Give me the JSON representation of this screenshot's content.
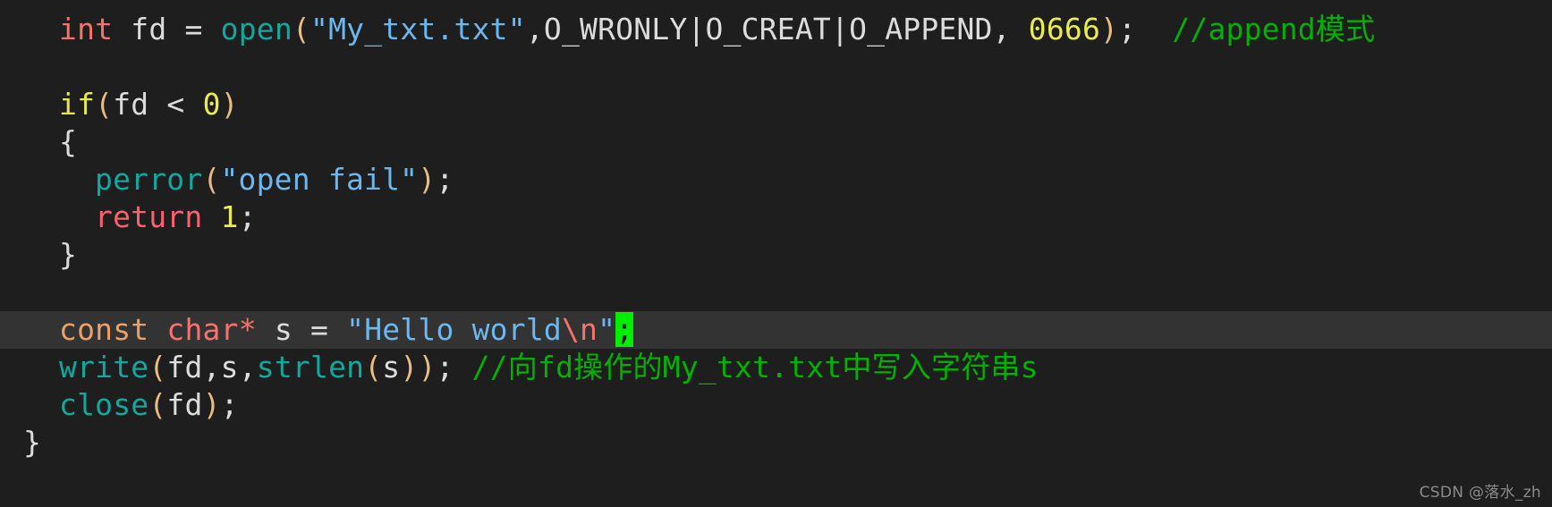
{
  "editor": {
    "background_color": "#1e1e1e",
    "highlight_line_color": "#333333",
    "default_text_color": "#d4d4d4",
    "language": "C",
    "palette": {
      "type_keyword": "#f8726c",
      "const_keyword": "#e9a06b",
      "control_keyword": "#e8e84a",
      "return_keyword": "#f8636c",
      "function": "#11a8a0",
      "string": "#6cb8ee",
      "escape": "#f8726c",
      "number": "#eaea55",
      "comment": "#00b100",
      "punctuation": "#e9bc82",
      "search_match_background": "#00ee00"
    },
    "lines": [
      {
        "id": "line-open",
        "indent": 0,
        "highlighted": false,
        "tokens": [
          {
            "text": "int",
            "style": "t-kw-type"
          },
          {
            "text": " fd ",
            "style": "t-plain"
          },
          {
            "text": "=",
            "style": "t-op"
          },
          {
            "text": " ",
            "style": "t-plain"
          },
          {
            "text": "open",
            "style": "t-func"
          },
          {
            "text": "(",
            "style": "t-punct"
          },
          {
            "text": "\"My_txt.txt\"",
            "style": "t-string"
          },
          {
            "text": ",",
            "style": "t-plain"
          },
          {
            "text": "O_WRONLY",
            "style": "t-plain"
          },
          {
            "text": "|",
            "style": "t-plain"
          },
          {
            "text": "O_CREAT",
            "style": "t-plain"
          },
          {
            "text": "|",
            "style": "t-plain"
          },
          {
            "text": "O_APPEND",
            "style": "t-plain"
          },
          {
            "text": ", ",
            "style": "t-plain"
          },
          {
            "text": "0666",
            "style": "t-number"
          },
          {
            "text": ")",
            "style": "t-punct"
          },
          {
            "text": ";",
            "style": "t-plain"
          },
          {
            "text": "  ",
            "style": "t-plain"
          },
          {
            "text": "//append模式",
            "style": "t-comment"
          }
        ]
      },
      {
        "id": "line-blank-1",
        "indent": 0,
        "highlighted": false,
        "tokens": []
      },
      {
        "id": "line-if",
        "indent": 0,
        "highlighted": false,
        "tokens": [
          {
            "text": "if",
            "style": "t-kw-ctrl"
          },
          {
            "text": "(",
            "style": "t-punct"
          },
          {
            "text": "fd ",
            "style": "t-plain"
          },
          {
            "text": "<",
            "style": "t-op"
          },
          {
            "text": " ",
            "style": "t-plain"
          },
          {
            "text": "0",
            "style": "t-number"
          },
          {
            "text": ")",
            "style": "t-punct"
          }
        ]
      },
      {
        "id": "line-open-brace",
        "indent": 0,
        "highlighted": false,
        "tokens": [
          {
            "text": "{",
            "style": "t-plain"
          }
        ]
      },
      {
        "id": "line-perror",
        "indent": 1,
        "highlighted": false,
        "tokens": [
          {
            "text": "perror",
            "style": "t-func"
          },
          {
            "text": "(",
            "style": "t-punct"
          },
          {
            "text": "\"open fail\"",
            "style": "t-string"
          },
          {
            "text": ")",
            "style": "t-punct"
          },
          {
            "text": ";",
            "style": "t-plain"
          }
        ]
      },
      {
        "id": "line-return",
        "indent": 1,
        "highlighted": false,
        "tokens": [
          {
            "text": "return",
            "style": "t-kw-return"
          },
          {
            "text": " ",
            "style": "t-plain"
          },
          {
            "text": "1",
            "style": "t-number"
          },
          {
            "text": ";",
            "style": "t-plain"
          }
        ]
      },
      {
        "id": "line-close-brace",
        "indent": 0,
        "highlighted": false,
        "tokens": [
          {
            "text": "}",
            "style": "t-plain"
          }
        ]
      },
      {
        "id": "line-blank-2",
        "indent": 0,
        "highlighted": false,
        "tokens": []
      },
      {
        "id": "line-const-char",
        "indent": 0,
        "highlighted": true,
        "tokens": [
          {
            "text": "const",
            "style": "t-kw-const"
          },
          {
            "text": " ",
            "style": "t-plain"
          },
          {
            "text": "char",
            "style": "t-kw-type"
          },
          {
            "text": "*",
            "style": "t-kw-type"
          },
          {
            "text": " s ",
            "style": "t-plain"
          },
          {
            "text": "=",
            "style": "t-op"
          },
          {
            "text": " ",
            "style": "t-plain"
          },
          {
            "text": "\"Hello world",
            "style": "t-string"
          },
          {
            "text": "\\n",
            "style": "t-escape"
          },
          {
            "text": "\"",
            "style": "t-string"
          },
          {
            "text": ";",
            "style": "t-hl-green"
          }
        ]
      },
      {
        "id": "line-write",
        "indent": 0,
        "highlighted": false,
        "tokens": [
          {
            "text": "write",
            "style": "t-func"
          },
          {
            "text": "(",
            "style": "t-punct"
          },
          {
            "text": "fd",
            "style": "t-plain"
          },
          {
            "text": ",",
            "style": "t-plain"
          },
          {
            "text": "s",
            "style": "t-plain"
          },
          {
            "text": ",",
            "style": "t-plain"
          },
          {
            "text": "strlen",
            "style": "t-func"
          },
          {
            "text": "(",
            "style": "t-punct"
          },
          {
            "text": "s",
            "style": "t-plain"
          },
          {
            "text": ")",
            "style": "t-punct"
          },
          {
            "text": ")",
            "style": "t-punct"
          },
          {
            "text": ";",
            "style": "t-plain"
          },
          {
            "text": " ",
            "style": "t-plain"
          },
          {
            "text": "//向fd操作的My_txt.txt中写入字符串s",
            "style": "t-comment"
          }
        ]
      },
      {
        "id": "line-close",
        "indent": 0,
        "highlighted": false,
        "tokens": [
          {
            "text": "close",
            "style": "t-func"
          },
          {
            "text": "(",
            "style": "t-punct"
          },
          {
            "text": "fd",
            "style": "t-plain"
          },
          {
            "text": ")",
            "style": "t-punct"
          },
          {
            "text": ";",
            "style": "t-plain"
          }
        ]
      },
      {
        "id": "line-final-brace",
        "indent": -1,
        "highlighted": false,
        "tokens": [
          {
            "text": "}",
            "style": "t-plain"
          }
        ]
      }
    ]
  },
  "watermark": {
    "text": "CSDN @落水_zh"
  }
}
